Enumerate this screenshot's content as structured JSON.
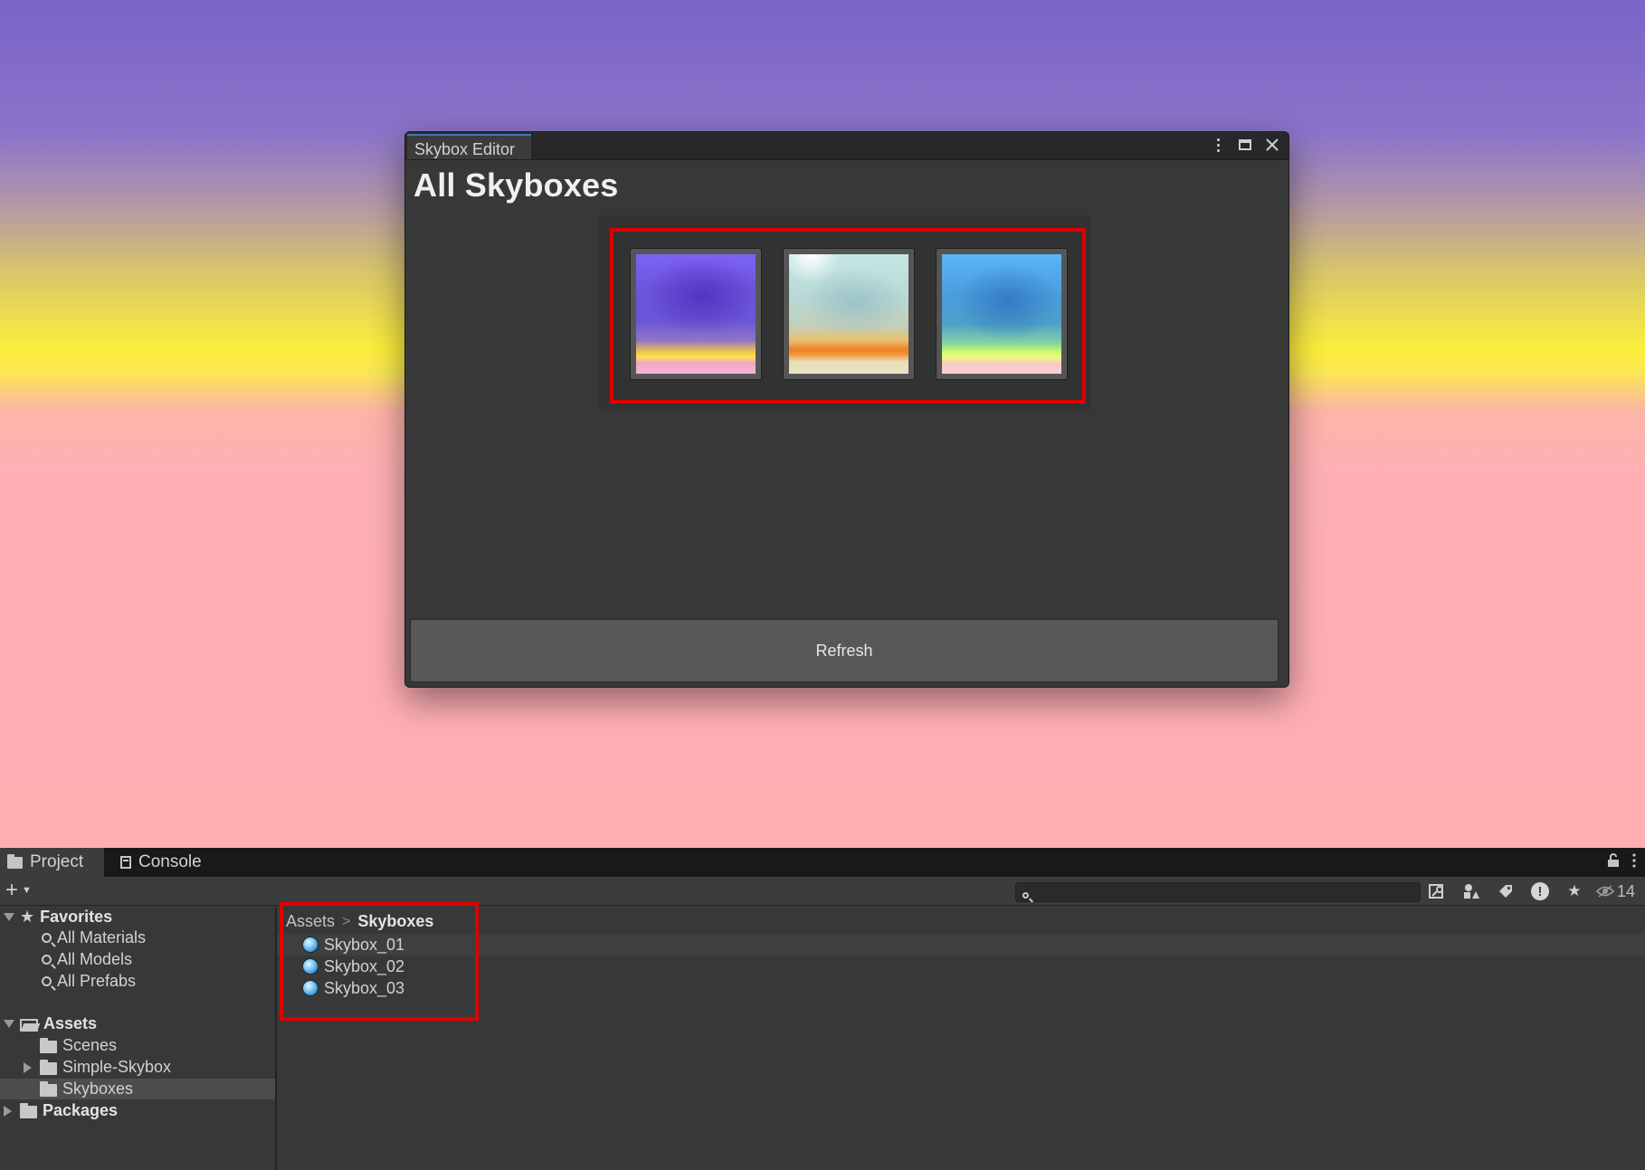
{
  "editor": {
    "tab_label": "Skybox Editor",
    "heading": "All Skyboxes",
    "thumbnails": [
      {
        "id": "skybox-thumb-1",
        "dominant_colors": [
          "#6a56d6",
          "#fbe54c",
          "#f4b4d6"
        ]
      },
      {
        "id": "skybox-thumb-2",
        "dominant_colors": [
          "#b8d9d6",
          "#ec8225",
          "#e6e2c6"
        ]
      },
      {
        "id": "skybox-thumb-3",
        "dominant_colors": [
          "#4a9ddc",
          "#cdfb6c",
          "#f9cdd6"
        ]
      }
    ],
    "refresh_label": "Refresh",
    "highlight_color": "#e00000"
  },
  "project_panel": {
    "tabs": [
      {
        "label": "Project",
        "icon": "folder-icon",
        "active": true
      },
      {
        "label": "Console",
        "icon": "console-icon",
        "active": false
      }
    ],
    "search": {
      "placeholder": ""
    },
    "hidden_packages_count": "14",
    "tree": {
      "favorites_label": "Favorites",
      "favorites": [
        "All Materials",
        "All Models",
        "All Prefabs"
      ],
      "assets_label": "Assets",
      "asset_folders": [
        {
          "label": "Scenes",
          "expandable": false
        },
        {
          "label": "Simple-Skybox",
          "expandable": true
        },
        {
          "label": "Skyboxes",
          "expandable": false,
          "selected": true
        }
      ],
      "packages_label": "Packages"
    },
    "breadcrumb": {
      "root": "Assets",
      "current": "Skyboxes"
    },
    "assets": [
      "Skybox_01",
      "Skybox_02",
      "Skybox_03"
    ]
  }
}
